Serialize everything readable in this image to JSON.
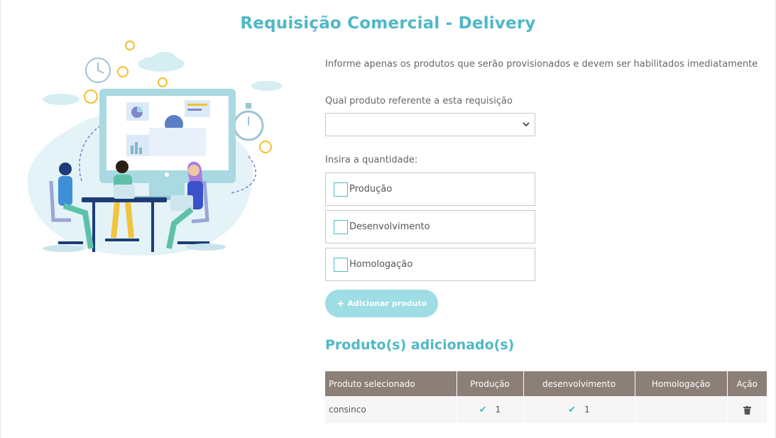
{
  "page": {
    "title": "Requisição Comercial - Delivery"
  },
  "form": {
    "intro": "Informe apenas os produtos que serão provisionados e devem ser habilitados imediatamente",
    "product_label": "Qual produto referente a esta requisição",
    "product_value": "",
    "quantity_label": "Insira a quantidade:",
    "environments": [
      {
        "label": "Produção",
        "checked": false
      },
      {
        "label": "Desenvolvimento",
        "checked": false
      },
      {
        "label": "Homologação",
        "checked": false
      }
    ],
    "add_button": "Adicionar produto"
  },
  "added": {
    "title": "Produto(s) adicionado(s)",
    "columns": [
      "Produto selecionado",
      "Produção",
      "desenvolvimento",
      "Homologação",
      "Ação"
    ],
    "rows": [
      {
        "product": "consinco",
        "producao": "1",
        "desenvolvimento": "1",
        "homologacao": ""
      }
    ]
  },
  "icons": {
    "check": "checkmark-icon",
    "delete": "trash-icon",
    "select": "chevron-down-icon",
    "add": "plus-icon"
  },
  "colors": {
    "accent": "#4fb8c6",
    "button": "#9ddde3",
    "table_header": "#8c7f78"
  }
}
